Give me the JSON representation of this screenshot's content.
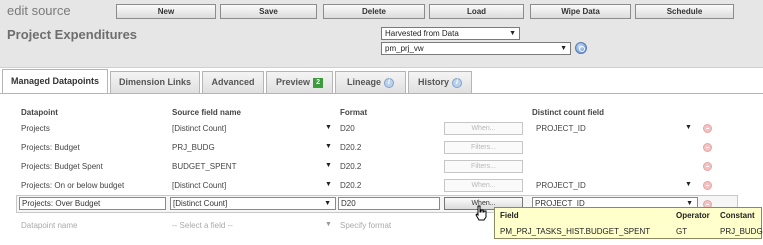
{
  "header": {
    "app_title": "edit source",
    "page_title": "Project Expenditures",
    "toolbar": [
      "New",
      "Save",
      "Delete",
      "Load",
      "Wipe Data",
      "Schedule"
    ],
    "source_type": "Harvested from Data",
    "source_name": "pm_prj_vw"
  },
  "tabs": [
    {
      "label": "Managed Datapoints",
      "active": true,
      "icon": ""
    },
    {
      "label": "Dimension Links",
      "active": false,
      "icon": ""
    },
    {
      "label": "Advanced",
      "active": false,
      "icon": ""
    },
    {
      "label": "Preview",
      "active": false,
      "icon": "2"
    },
    {
      "label": "Lineage",
      "active": false,
      "icon": "i"
    },
    {
      "label": "History",
      "active": false,
      "icon": "i"
    }
  ],
  "columns": {
    "datapoint": "Datapoint",
    "source_field": "Source field name",
    "format": "Format",
    "distinct": "Distinct count field"
  },
  "rows": [
    {
      "datapoint": "Projects",
      "source_field": "[Distinct Count]",
      "format": "D20",
      "button": "When...",
      "distinct": "PROJECT_ID"
    },
    {
      "datapoint": "Projects: Budget",
      "source_field": "PRJ_BUDG",
      "format": "D20.2",
      "button": "Filters...",
      "distinct": ""
    },
    {
      "datapoint": "Projects: Budget Spent",
      "source_field": "BUDGET_SPENT",
      "format": "D20.2",
      "button": "Filters...",
      "distinct": ""
    },
    {
      "datapoint": "Projects: On or below budget",
      "source_field": "[Distinct Count]",
      "format": "D20.2",
      "button": "When...",
      "distinct": "PROJECT_ID"
    }
  ],
  "edit_row": {
    "datapoint": "Projects: Over Budget",
    "source_field": "[Distinct Count]",
    "format": "D20",
    "button": "When...",
    "distinct": "PROJECT_ID"
  },
  "new_row": {
    "datapoint": "Datapoint name",
    "source_field": "-- Select a field --",
    "format": "Specify format"
  },
  "tooltip": {
    "headers": {
      "field": "Field",
      "operator": "Operator",
      "constant": "Constant"
    },
    "field": "PM_PRJ_TASKS_HIST.BUDGET_SPENT",
    "operator": "GT",
    "constant": "PRJ_BUDG"
  },
  "colors": {
    "header_bg": "#e6e6e6",
    "tooltip_bg": "#ffffcc",
    "delete_icon": "#f4c2c2",
    "preview_badge": "#3c9b3c"
  }
}
